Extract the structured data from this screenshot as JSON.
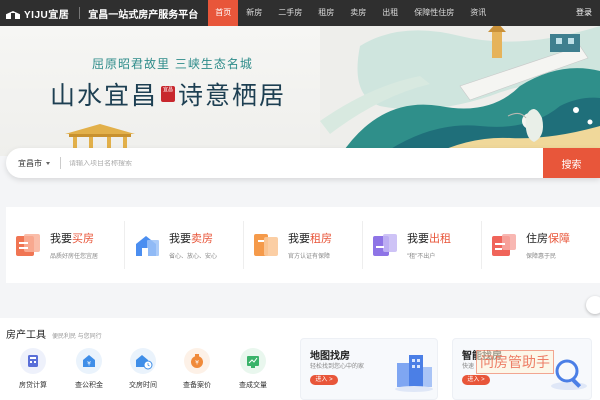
{
  "brand": {
    "name": "YIJU宜居",
    "slogan": "宜昌一站式房产服务平台"
  },
  "nav": {
    "items": [
      "首页",
      "新房",
      "二手房",
      "租房",
      "卖房",
      "出租",
      "保障性住房",
      "资讯"
    ],
    "active": "首页",
    "login": "登录"
  },
  "banner": {
    "tagline": "屈原昭君故里   三峡生态名城",
    "headline_left": "山水宜昌",
    "seal": "宜昌",
    "headline_right": "诗意栖居"
  },
  "search": {
    "city": "宜昌市",
    "placeholder": "请输入项目名称搜索",
    "button": "搜索"
  },
  "services": [
    {
      "prefix": "我要",
      "highlight": "买房",
      "sub": "品质好房任您宜居",
      "icon": "buy-house-icon",
      "color": "#f07553"
    },
    {
      "prefix": "我要",
      "highlight": "卖房",
      "sub": "省心、放心、安心",
      "icon": "sell-house-icon",
      "color": "#4b8ef0"
    },
    {
      "prefix": "我要",
      "highlight": "租房",
      "sub": "官方认证有保障",
      "icon": "rent-house-icon",
      "color": "#f59a4a"
    },
    {
      "prefix": "我要",
      "highlight": "出租",
      "sub": "\"租\"不出户",
      "icon": "lease-out-icon",
      "color": "#8e74e6"
    },
    {
      "prefix": "住房",
      "highlight": "保障",
      "sub": "保障惠于民",
      "icon": "housing-security-icon",
      "color": "#f0645a"
    }
  ],
  "tools": {
    "title": "房产工具",
    "subtitle": "便民利民 与您同行",
    "items": [
      {
        "label": "房贷计算",
        "icon": "calculator-icon",
        "bg": "#eef1fb",
        "fg": "#5a6fd8"
      },
      {
        "label": "查公积金",
        "icon": "fund-icon",
        "bg": "#eaf3fc",
        "fg": "#3f8ee8"
      },
      {
        "label": "交房时间",
        "icon": "house-clock-icon",
        "bg": "#eaf3fc",
        "fg": "#3f8ee8"
      },
      {
        "label": "查备案价",
        "icon": "money-bag-icon",
        "bg": "#fdf1e7",
        "fg": "#f08a3a"
      },
      {
        "label": "查成交量",
        "icon": "trend-chart-icon",
        "bg": "#e9f7ee",
        "fg": "#3ab36a"
      }
    ]
  },
  "promos": [
    {
      "title": "地图找房",
      "sub": "轻松找到您心中的家",
      "button": "进入 >"
    },
    {
      "title": "智能找房",
      "sub": "快速",
      "button": "进入 >"
    }
  ],
  "watermark": "问房管助手"
}
